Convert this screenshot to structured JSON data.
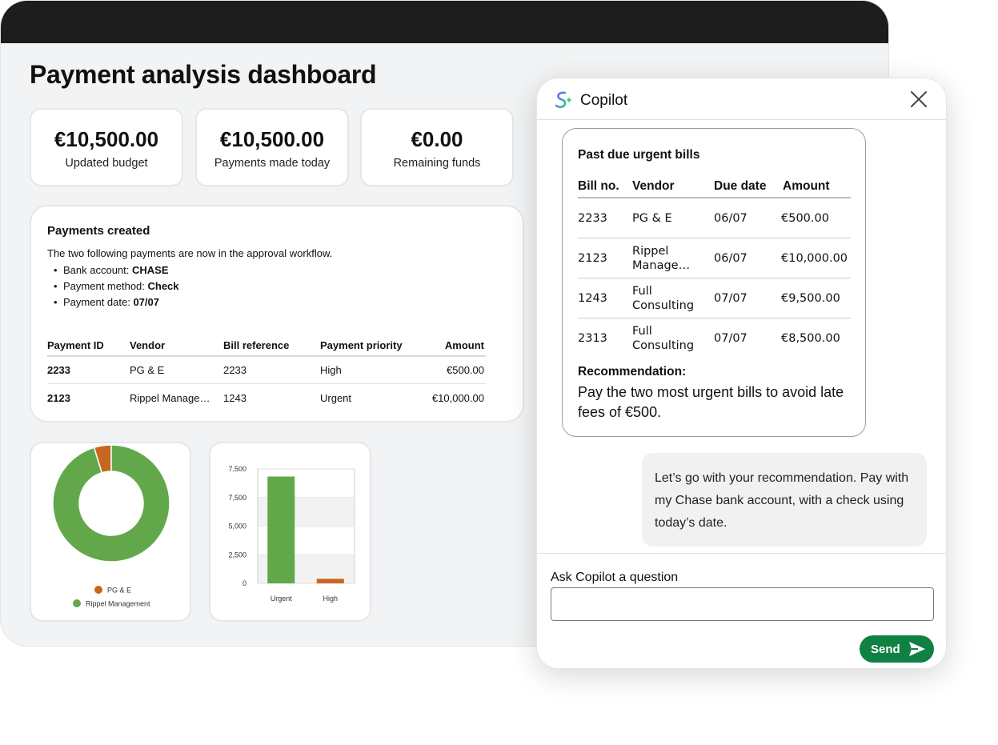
{
  "dashboard": {
    "title": "Payment analysis dashboard",
    "stats": [
      {
        "value": "€10,500.00",
        "label": "Updated budget"
      },
      {
        "value": "€10,500.00",
        "label": "Payments made today"
      },
      {
        "value": "€0.00",
        "label": "Remaining funds"
      }
    ],
    "payments": {
      "title": "Payments created",
      "description": "The two following payments are now in the approval workflow.",
      "details": [
        {
          "label": "Bank account: ",
          "value": "CHASE"
        },
        {
          "label": "Payment method: ",
          "value": "Check"
        },
        {
          "label": "Payment date: ",
          "value": "07/07"
        }
      ],
      "columns": [
        "Payment ID",
        "Vendor",
        "Bill reference",
        "Payment priority",
        "Amount"
      ],
      "rows": [
        [
          "2233",
          "PG & E",
          "2233",
          "High",
          "€500.00"
        ],
        [
          "2123",
          "Rippel Manage…",
          "1243",
          "Urgent",
          "€10,000.00"
        ]
      ]
    }
  },
  "chart_data": [
    {
      "type": "pie",
      "categories": [
        "PG & E",
        "Rippel Management"
      ],
      "values": [
        500,
        10000
      ],
      "colors": [
        "#c8671f",
        "#62a84b"
      ],
      "legend_placement": "bottom"
    },
    {
      "type": "bar",
      "categories": [
        "Urgent",
        "High"
      ],
      "values": [
        7000,
        300
      ],
      "colors": [
        "#62a84b",
        "#c8671f"
      ],
      "yticks": [
        "7,500",
        "7,500",
        "5,000",
        "2,500",
        "0"
      ],
      "ylim": [
        0,
        7500
      ],
      "grid": true
    }
  ],
  "copilot": {
    "title": "Copilot",
    "bills": {
      "title": "Past due urgent bills",
      "columns": [
        "Bill no.",
        "Vendor",
        "Due date",
        "Amount"
      ],
      "rows": [
        [
          "2233",
          "PG & E",
          "06/07",
          "€500.00"
        ],
        [
          "2123",
          "Rippel Manage…",
          "06/07",
          "€10,000.00"
        ],
        [
          "1243",
          "Full Consulting",
          "07/07",
          "€9,500.00"
        ],
        [
          "2313",
          "Full Consulting",
          "07/07",
          "€8,500.00"
        ]
      ],
      "recommendation_label": "Recommendation:",
      "recommendation_text": "Pay the two most urgent bills to avoid late fees of €500."
    },
    "user_message": "Let’s go with your recommendation. Pay with my Chase bank account, with a check using today’s date.",
    "ask_label": "Ask Copilot a question",
    "input_value": "",
    "send_label": "Send",
    "accent": "#108043"
  }
}
